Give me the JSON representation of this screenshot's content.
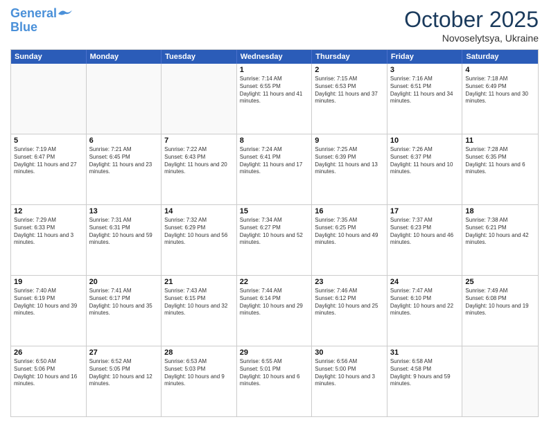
{
  "logo": {
    "line1": "General",
    "line2": "Blue"
  },
  "title": "October 2025",
  "subtitle": "Novoselytsya, Ukraine",
  "headers": [
    "Sunday",
    "Monday",
    "Tuesday",
    "Wednesday",
    "Thursday",
    "Friday",
    "Saturday"
  ],
  "rows": [
    [
      {
        "day": "",
        "text": ""
      },
      {
        "day": "",
        "text": ""
      },
      {
        "day": "",
        "text": ""
      },
      {
        "day": "1",
        "text": "Sunrise: 7:14 AM\nSunset: 6:55 PM\nDaylight: 11 hours and 41 minutes."
      },
      {
        "day": "2",
        "text": "Sunrise: 7:15 AM\nSunset: 6:53 PM\nDaylight: 11 hours and 37 minutes."
      },
      {
        "day": "3",
        "text": "Sunrise: 7:16 AM\nSunset: 6:51 PM\nDaylight: 11 hours and 34 minutes."
      },
      {
        "day": "4",
        "text": "Sunrise: 7:18 AM\nSunset: 6:49 PM\nDaylight: 11 hours and 30 minutes."
      }
    ],
    [
      {
        "day": "5",
        "text": "Sunrise: 7:19 AM\nSunset: 6:47 PM\nDaylight: 11 hours and 27 minutes."
      },
      {
        "day": "6",
        "text": "Sunrise: 7:21 AM\nSunset: 6:45 PM\nDaylight: 11 hours and 23 minutes."
      },
      {
        "day": "7",
        "text": "Sunrise: 7:22 AM\nSunset: 6:43 PM\nDaylight: 11 hours and 20 minutes."
      },
      {
        "day": "8",
        "text": "Sunrise: 7:24 AM\nSunset: 6:41 PM\nDaylight: 11 hours and 17 minutes."
      },
      {
        "day": "9",
        "text": "Sunrise: 7:25 AM\nSunset: 6:39 PM\nDaylight: 11 hours and 13 minutes."
      },
      {
        "day": "10",
        "text": "Sunrise: 7:26 AM\nSunset: 6:37 PM\nDaylight: 11 hours and 10 minutes."
      },
      {
        "day": "11",
        "text": "Sunrise: 7:28 AM\nSunset: 6:35 PM\nDaylight: 11 hours and 6 minutes."
      }
    ],
    [
      {
        "day": "12",
        "text": "Sunrise: 7:29 AM\nSunset: 6:33 PM\nDaylight: 11 hours and 3 minutes."
      },
      {
        "day": "13",
        "text": "Sunrise: 7:31 AM\nSunset: 6:31 PM\nDaylight: 10 hours and 59 minutes."
      },
      {
        "day": "14",
        "text": "Sunrise: 7:32 AM\nSunset: 6:29 PM\nDaylight: 10 hours and 56 minutes."
      },
      {
        "day": "15",
        "text": "Sunrise: 7:34 AM\nSunset: 6:27 PM\nDaylight: 10 hours and 52 minutes."
      },
      {
        "day": "16",
        "text": "Sunrise: 7:35 AM\nSunset: 6:25 PM\nDaylight: 10 hours and 49 minutes."
      },
      {
        "day": "17",
        "text": "Sunrise: 7:37 AM\nSunset: 6:23 PM\nDaylight: 10 hours and 46 minutes."
      },
      {
        "day": "18",
        "text": "Sunrise: 7:38 AM\nSunset: 6:21 PM\nDaylight: 10 hours and 42 minutes."
      }
    ],
    [
      {
        "day": "19",
        "text": "Sunrise: 7:40 AM\nSunset: 6:19 PM\nDaylight: 10 hours and 39 minutes."
      },
      {
        "day": "20",
        "text": "Sunrise: 7:41 AM\nSunset: 6:17 PM\nDaylight: 10 hours and 35 minutes."
      },
      {
        "day": "21",
        "text": "Sunrise: 7:43 AM\nSunset: 6:15 PM\nDaylight: 10 hours and 32 minutes."
      },
      {
        "day": "22",
        "text": "Sunrise: 7:44 AM\nSunset: 6:14 PM\nDaylight: 10 hours and 29 minutes."
      },
      {
        "day": "23",
        "text": "Sunrise: 7:46 AM\nSunset: 6:12 PM\nDaylight: 10 hours and 25 minutes."
      },
      {
        "day": "24",
        "text": "Sunrise: 7:47 AM\nSunset: 6:10 PM\nDaylight: 10 hours and 22 minutes."
      },
      {
        "day": "25",
        "text": "Sunrise: 7:49 AM\nSunset: 6:08 PM\nDaylight: 10 hours and 19 minutes."
      }
    ],
    [
      {
        "day": "26",
        "text": "Sunrise: 6:50 AM\nSunset: 5:06 PM\nDaylight: 10 hours and 16 minutes."
      },
      {
        "day": "27",
        "text": "Sunrise: 6:52 AM\nSunset: 5:05 PM\nDaylight: 10 hours and 12 minutes."
      },
      {
        "day": "28",
        "text": "Sunrise: 6:53 AM\nSunset: 5:03 PM\nDaylight: 10 hours and 9 minutes."
      },
      {
        "day": "29",
        "text": "Sunrise: 6:55 AM\nSunset: 5:01 PM\nDaylight: 10 hours and 6 minutes."
      },
      {
        "day": "30",
        "text": "Sunrise: 6:56 AM\nSunset: 5:00 PM\nDaylight: 10 hours and 3 minutes."
      },
      {
        "day": "31",
        "text": "Sunrise: 6:58 AM\nSunset: 4:58 PM\nDaylight: 9 hours and 59 minutes."
      },
      {
        "day": "",
        "text": ""
      }
    ]
  ]
}
